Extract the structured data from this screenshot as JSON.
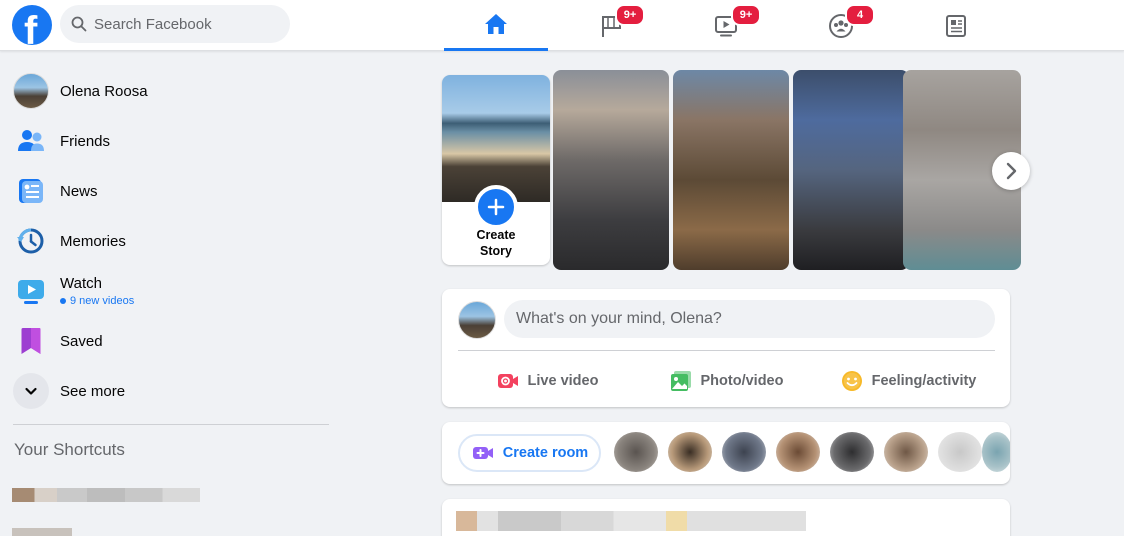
{
  "header": {
    "logo": "facebook-logo",
    "search_placeholder": "Search Facebook",
    "tabs": [
      {
        "name": "home",
        "icon": "home-icon",
        "active": true,
        "badge": ""
      },
      {
        "name": "pages",
        "icon": "flag-icon",
        "active": false,
        "badge": "9+"
      },
      {
        "name": "watch",
        "icon": "video-icon",
        "active": false,
        "badge": "9+"
      },
      {
        "name": "groups",
        "icon": "groups-icon",
        "active": false,
        "badge": "4"
      },
      {
        "name": "news",
        "icon": "news-icon",
        "active": false,
        "badge": ""
      }
    ]
  },
  "sidebar": {
    "items": [
      {
        "label": "Olena Roosa",
        "icon": "profile-avatar"
      },
      {
        "label": "Friends",
        "icon": "friends-icon"
      },
      {
        "label": "News",
        "icon": "news-icon"
      },
      {
        "label": "Memories",
        "icon": "memories-clock-icon"
      },
      {
        "label": "Watch",
        "icon": "watch-icon",
        "sub": "9 new videos"
      },
      {
        "label": "Saved",
        "icon": "bookmark-icon"
      },
      {
        "label": "See more",
        "icon": "chevron-down-icon"
      }
    ],
    "shortcuts_title": "Your Shortcuts"
  },
  "stories": {
    "create_label_line1": "Create",
    "create_label_line2": "Story"
  },
  "composer": {
    "placeholder": "What's on your mind, Olena?",
    "buttons": [
      {
        "label": "Live video",
        "icon": "live-video-icon"
      },
      {
        "label": "Photo/video",
        "icon": "photo-icon"
      },
      {
        "label": "Feeling/activity",
        "icon": "smiley-icon"
      }
    ]
  },
  "rooms": {
    "create_label": "Create room"
  },
  "colors": {
    "brand": "#1877f2",
    "badge": "#e41e3f",
    "background": "#f0f2f5",
    "live": "#f3425f",
    "photo": "#45bd62",
    "feeling": "#f7b928",
    "room": "#9360f7"
  }
}
